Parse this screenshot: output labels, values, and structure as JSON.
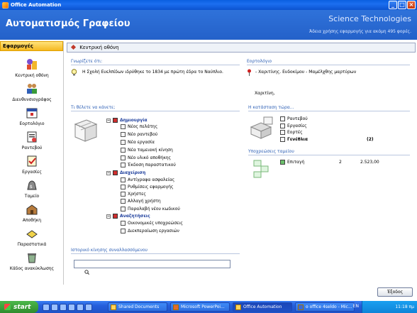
{
  "window": {
    "title": "Office Automation",
    "buttons": {
      "minimize": "_",
      "maximize": "□",
      "close": "×"
    }
  },
  "header": {
    "title": "Αυτοματισμός Γραφείου",
    "brand": "Science Technologies",
    "subtitle": "Άδεια χρήσης εφαρμογής για ακόμη 495 φορές."
  },
  "sidebar": {
    "heading": "Εφαρμογές",
    "items": [
      {
        "label": "Κεντρική οθόνη",
        "icon": "home-icon"
      },
      {
        "label": "Διευθυνσιογράφος",
        "icon": "contacts-icon"
      },
      {
        "label": "Εορτολόγιο",
        "icon": "calendar-icon"
      },
      {
        "label": "Ραντεβού",
        "icon": "appointment-icon"
      },
      {
        "label": "Εργασίες",
        "icon": "tasks-icon"
      },
      {
        "label": "Ταμείο",
        "icon": "cashbox-icon"
      },
      {
        "label": "Αποθήκη",
        "icon": "warehouse-icon"
      },
      {
        "label": "Παραστατικά",
        "icon": "documents-icon"
      },
      {
        "label": "Κάδος ανακύκλωσης",
        "icon": "recycle-bin-icon"
      }
    ]
  },
  "breadcrumb": "Κεντρική οθόνη",
  "did_you_know": {
    "label": "Γνωρίζετε ότι:",
    "text": "Η Σχολή Ευελπίδων ιδρύθηκε το 1834 με πρώτη έδρα το Ναύπλιο."
  },
  "name_days": {
    "label": "Εορτολόγιο",
    "text": "- Χαριτίνης. Ευδοκίμου - Μαμέλχθης μαρτύρων",
    "names": "Χαριτίνη,"
  },
  "what_to_do": {
    "label": "Τι θέλετε να κάνετε;",
    "groups": [
      {
        "title": "Δημιουργία",
        "items": [
          "Νέος πελάτης",
          "Νέο ραντεβού",
          "Νέα εργασία",
          "Νέα ταμειακή κίνηση",
          "Νέο υλικό αποθήκης",
          "Έκδοση παραστατικού"
        ]
      },
      {
        "title": "Διαχείριση",
        "items": [
          "Αντίγραφα ασφαλείας",
          "Ρυθμίσεις εφαρμογής",
          "Χρήστες",
          "Αλλαγή χρήστη",
          "Παραλαβή νέου κωδικού"
        ]
      },
      {
        "title": "Αναζητήσεις",
        "items": [
          "Οικονομικές υποχρεώσεις",
          "Διεκπεραίωση εργασιών"
        ]
      }
    ]
  },
  "status_today": {
    "label": "Η κατάσταση τώρα...",
    "rows": [
      {
        "label": "Ραντεβού",
        "count": ""
      },
      {
        "label": "Εργασίες",
        "count": ""
      },
      {
        "label": "Εορτές",
        "count": ""
      },
      {
        "label": "Γενέθλια",
        "count": "(2)"
      }
    ]
  },
  "obligations": {
    "label": "Υποχρεώσεις ταμείου",
    "rows": [
      {
        "label": "Επιταγή",
        "count": "2",
        "amount": "2.523,00"
      }
    ]
  },
  "history": {
    "label": "Ιστορικό κίνησης συναλλασσόμενου",
    "value": ""
  },
  "exit_button": "Έξοδος",
  "taskbar": {
    "start": "start",
    "tasks": [
      "Shared Documents",
      "Microsoft PowerPoi...",
      "Office Automation",
      "o office 4seldo - Mic..."
    ],
    "lang": "EN",
    "clock": "11:18 πμ"
  }
}
